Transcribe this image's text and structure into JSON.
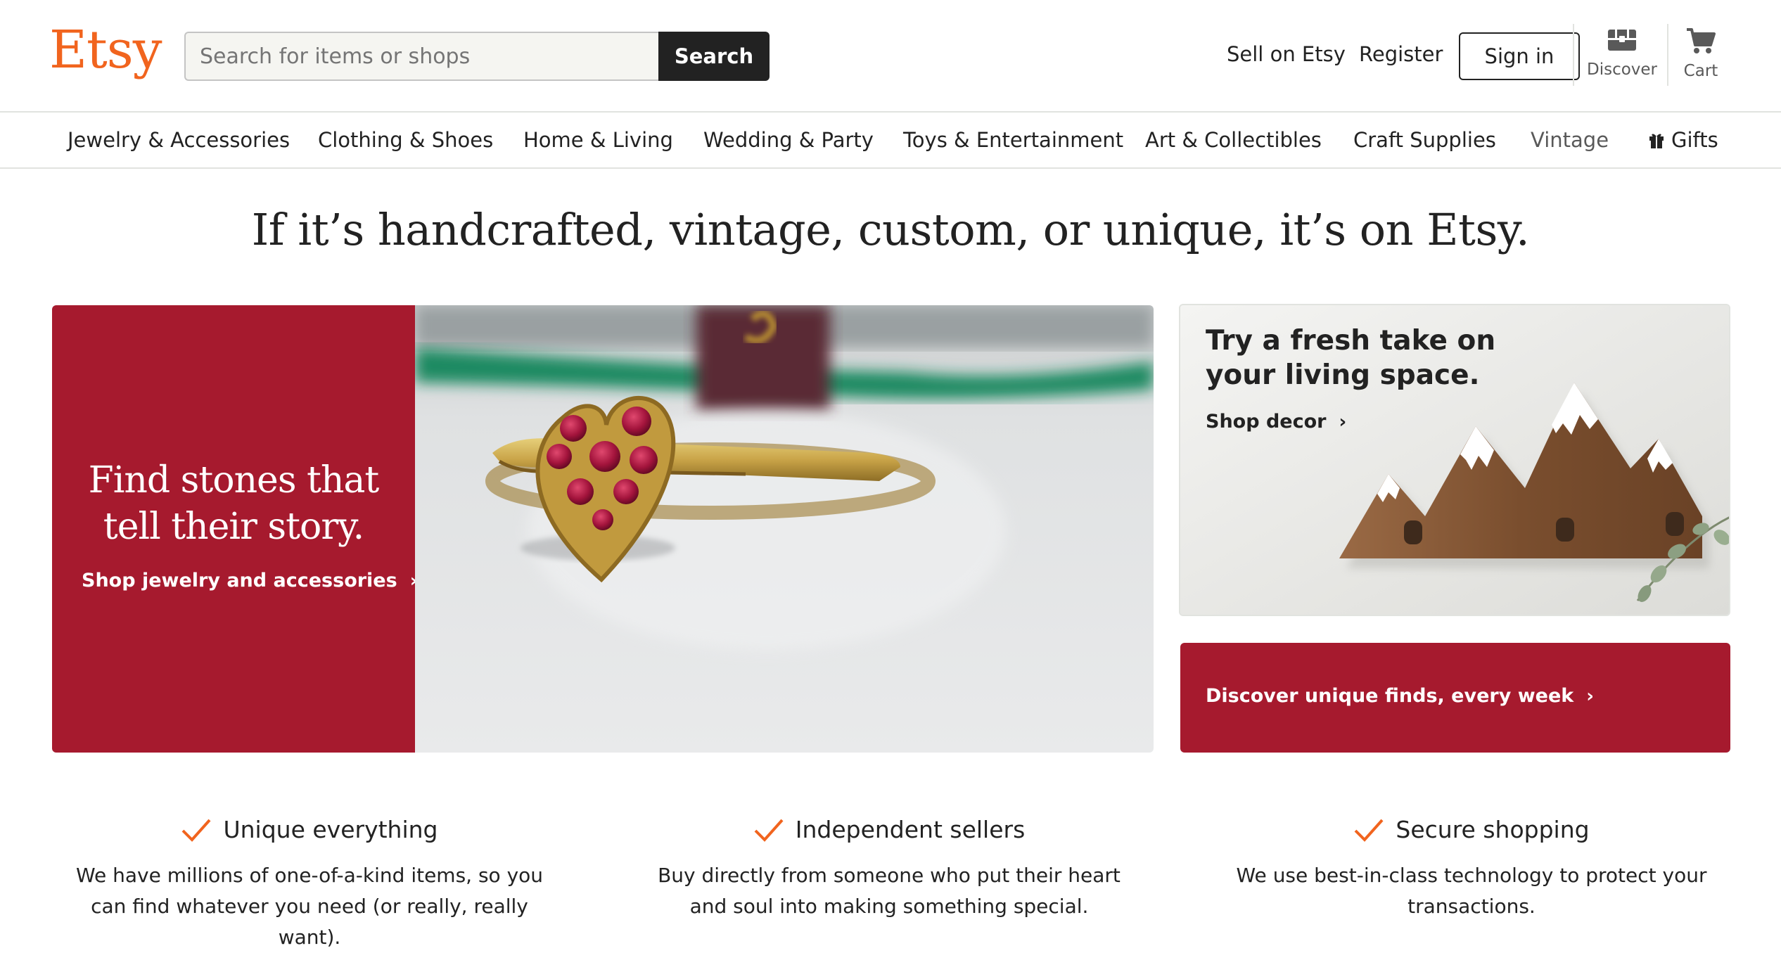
{
  "colors": {
    "brand_orange": "#f1641e",
    "hero_red": "#a61a2e",
    "text": "#222222",
    "muted": "#595959"
  },
  "header": {
    "logo": "Etsy",
    "search": {
      "placeholder": "Search for items or shops",
      "value": "",
      "button_label": "Search"
    },
    "links": {
      "sell": "Sell on Etsy",
      "register": "Register",
      "sign_in": "Sign in"
    },
    "icons": [
      {
        "name": "discover-icon",
        "label": "Discover"
      },
      {
        "name": "cart-icon",
        "label": "Cart"
      }
    ]
  },
  "categories": [
    "Jewelry & Accessories",
    "Clothing & Shoes",
    "Home & Living",
    "Wedding & Party",
    "Toys & Entertainment",
    "Art & Collectibles",
    "Craft Supplies",
    "Vintage",
    "Gifts"
  ],
  "tagline": "If it’s handcrafted, vintage, custom, or unique, it’s on Etsy.",
  "hero": {
    "main": {
      "title": "Find stones that tell their story.",
      "link": "Shop jewelry and accessories",
      "image": "heart-ruby-ring-photo"
    },
    "decor": {
      "title": "Try a fresh take on your living space.",
      "link": "Shop decor",
      "image": "mountain-coat-rack-photo"
    },
    "discover": {
      "link": "Discover unique finds, every week"
    }
  },
  "value_props": [
    {
      "title": "Unique everything",
      "description": "We have millions of one-of-a-kind items, so you can find whatever you need (or really, really want)."
    },
    {
      "title": "Independent sellers",
      "description": "Buy directly from someone who put their heart and soul into making something special."
    },
    {
      "title": "Secure shopping",
      "description": "We use best-in-class technology to protect your transactions."
    }
  ]
}
